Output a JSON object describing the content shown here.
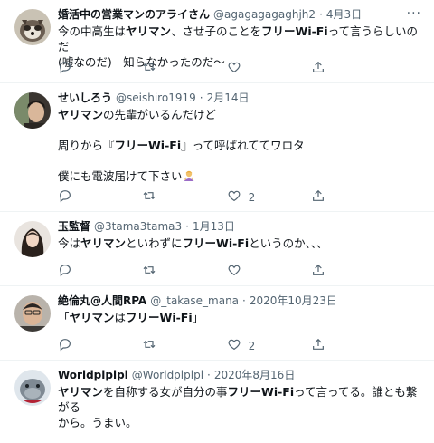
{
  "more_glyph": "···",
  "tweets": [
    {
      "name": "婚活中の営業マンのアライさん",
      "handle": "@agagagagaghjh2",
      "sep": "·",
      "date": "4月3日",
      "lines": [
        [
          {
            "t": "今の中高生は"
          },
          {
            "t": "ヤリマン",
            "b": true
          },
          {
            "t": "、させ子のことを"
          },
          {
            "t": "フリーWi-Fi",
            "b": true
          },
          {
            "t": "って言うらしいのだ"
          }
        ],
        [
          {
            "t": "(嘘なのだ)　知らなかったのだ〜"
          }
        ]
      ],
      "likes": ""
    },
    {
      "name": "せいしろう",
      "handle": "@seishiro1919",
      "sep": "·",
      "date": "2月14日",
      "lines": [
        [
          {
            "t": "ヤリマン",
            "b": true
          },
          {
            "t": "の先輩がいるんだけど"
          }
        ],
        [
          {
            "t": ""
          }
        ],
        [
          {
            "t": "周りから『"
          },
          {
            "t": "フリーWi-Fi",
            "b": true
          },
          {
            "t": "』って呼ばれててワロタ"
          }
        ],
        [
          {
            "t": ""
          }
        ],
        [
          {
            "t": "僕にも電波届けて下さい"
          },
          {
            "emoji": true
          }
        ]
      ],
      "likes": "2"
    },
    {
      "name": "玉監督",
      "handle": "@3tama3tama3",
      "sep": "·",
      "date": "1月13日",
      "lines": [
        [
          {
            "t": "今は"
          },
          {
            "t": "ヤリマン",
            "b": true
          },
          {
            "t": "といわずに"
          },
          {
            "t": "フリーWi-Fi",
            "b": true
          },
          {
            "t": "というのか、、、"
          }
        ]
      ],
      "likes": ""
    },
    {
      "name": "絶倫丸@人間RPA",
      "handle": "@_takase_mana",
      "sep": "·",
      "date": "2020年10月23日",
      "lines": [
        [
          {
            "t": "「"
          },
          {
            "t": "ヤリマン",
            "b": true
          },
          {
            "t": "は"
          },
          {
            "t": "フリーWi-Fi",
            "b": true
          },
          {
            "t": "」"
          }
        ]
      ],
      "likes": "2"
    },
    {
      "name": "Worldplplpl",
      "handle": "@Worldplplpl",
      "sep": "·",
      "date": "2020年8月16日",
      "lines": [
        [
          {
            "t": "ヤリマン",
            "b": true
          },
          {
            "t": "を自称する女が自分の事"
          },
          {
            "t": "フリーWi-Fi",
            "b": true
          },
          {
            "t": "って言ってる。誰とも繋がる"
          }
        ],
        [
          {
            "t": "から。うまい。"
          }
        ]
      ],
      "likes": ""
    }
  ]
}
